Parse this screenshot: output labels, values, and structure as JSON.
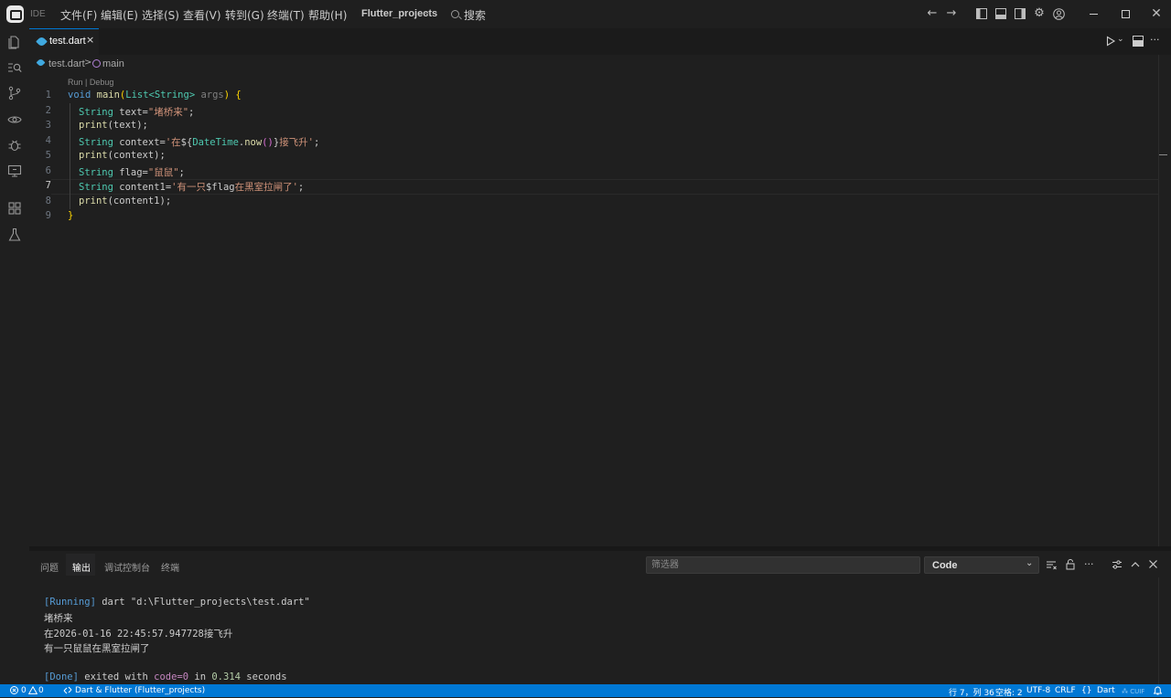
{
  "titlebar": {
    "ide_label": "IDE",
    "menu": [
      "文件(F)",
      "编辑(E)",
      "选择(S)",
      "查看(V)",
      "转到(G)",
      "终端(T)",
      "帮助(H)"
    ],
    "project": "Flutter_projects",
    "search_label": "搜索",
    "icons": [
      "back-arrow-icon",
      "forward-arrow-icon",
      "toggle-primary-sidebar-icon",
      "toggle-panel-icon",
      "toggle-secondary-sidebar-icon",
      "settings-icon",
      "account-icon",
      "minimize-icon",
      "restore-icon",
      "close-icon"
    ]
  },
  "activity_bar": [
    "explorer-icon",
    "search-icon",
    "source-control-icon",
    "watch-icon",
    "debug-icon",
    "remote-explorer-icon",
    "extensions-icon",
    "testing-icon"
  ],
  "editor": {
    "tab": {
      "label": "test.dart",
      "close": "×"
    },
    "breadcrumb": {
      "file": "test.dart",
      "separator": ">",
      "symbol": "main"
    },
    "codelens": "Run | Debug",
    "line_numbers": [
      "1",
      "2",
      "3",
      "4",
      "5",
      "6",
      "7",
      "8",
      "9"
    ],
    "active_line": 7,
    "code": {
      "l1": {
        "kw": "void",
        "fn": "main",
        "p1": "(",
        "ty1": "List",
        "lt": "<",
        "ty2": "String",
        "gt": ">",
        "param": "args",
        "p2": ")",
        "brace": "{"
      },
      "l2": {
        "ty": "String",
        "rest": " text=",
        "str": "\"堵桥来\"",
        "end": ";"
      },
      "l3": {
        "fn": "print",
        "rest": "(text);"
      },
      "l4": {
        "ty": "String",
        "rest": " context=",
        "s1": "'在",
        "interp_open": "${",
        "cls": "DateTime",
        "dot": ".",
        "fn": "now",
        "call": "()",
        "interp_close": "}",
        "s2": "接飞升'",
        "end": ";"
      },
      "l5": {
        "fn": "print",
        "rest": "(context);"
      },
      "l6": {
        "ty": "String",
        "rest": " flag=",
        "str": "\"鼠鼠\"",
        "end": ";"
      },
      "l7": {
        "ty": "String",
        "rest": " content1=",
        "s1": "'有一只",
        "var": "$flag",
        "s2": "在黑室拉闸了'",
        "end": ";"
      },
      "l8": {
        "fn": "print",
        "rest": "(content1);"
      },
      "l9": {
        "brace": "}"
      }
    }
  },
  "panel": {
    "tabs": [
      "问题",
      "输出",
      "调试控制台",
      "终端"
    ],
    "active_tab": "输出",
    "filter_placeholder": "筛选器",
    "channel": "Code",
    "icons": [
      "clear-output-icon",
      "lock-scroll-icon",
      "more-actions-icon",
      "panel-layout-icon",
      "maximize-panel-icon",
      "close-panel-icon"
    ],
    "output": {
      "running_tag": "[Running]",
      "running_cmd": " dart \"d:\\Flutter_projects\\test.dart\"",
      "line1": "堵桥来",
      "line2": "在2026-01-16 22:45:57.947728接飞升",
      "line3": "有一只鼠鼠在黑室拉闸了",
      "done_tag": "[Done]",
      "done_text1": " exited with ",
      "done_code": "code=0",
      "done_text2": " in ",
      "done_time": "0.314",
      "done_text3": " seconds"
    }
  },
  "statusbar": {
    "errors": "0",
    "warnings": "0",
    "remote": "Dart & Flutter (Flutter_projects)",
    "position": "行 7，列 36",
    "spaces": "空格: 2",
    "encoding": "UTF-8",
    "eol": "CRLF",
    "braces": "{}",
    "language": "Dart",
    "flutter_device": "CUIF",
    "colors": {
      "accent": "#0078d4",
      "background": "#1f1f1f"
    }
  }
}
